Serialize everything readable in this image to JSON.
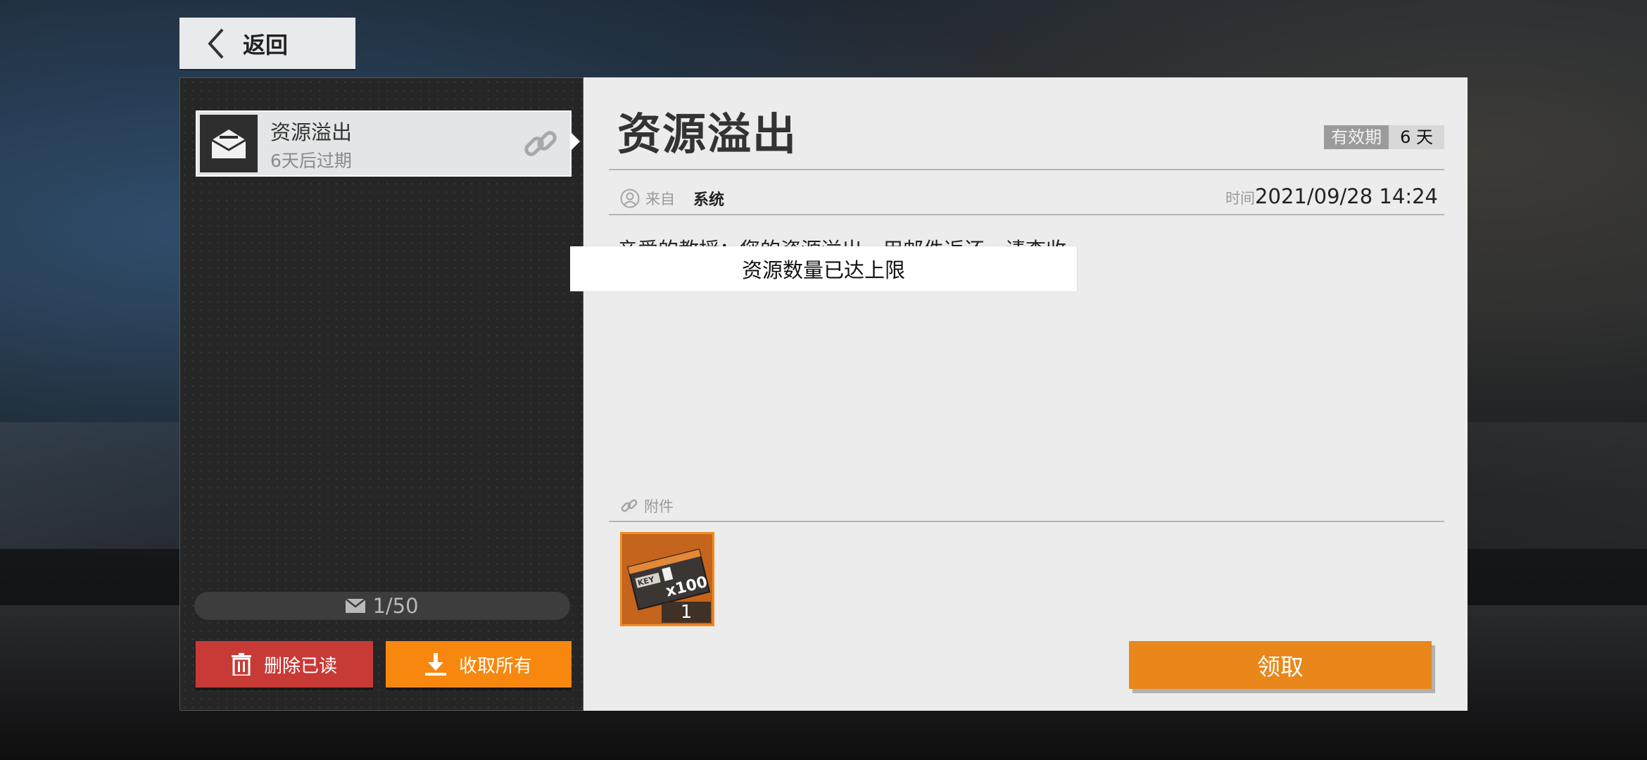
{
  "header": {
    "back_label": "返回"
  },
  "mail_list": {
    "items": [
      {
        "title": "资源溢出",
        "subtitle": "6天后过期"
      }
    ],
    "count_text": "1/50",
    "delete_read_label": "删除已读",
    "collect_all_label": "收取所有"
  },
  "detail": {
    "title": "资源溢出",
    "validity_label": "有效期",
    "validity_value": "6 天",
    "from_label": "来自",
    "from_value": "系统",
    "time_label": "时间",
    "time_value": "2021/09/28 14:24",
    "body": "亲爱的教授：您的资源溢出，用邮件返还，请查收",
    "attachments_label": "附件",
    "attachment_item": {
      "name": "KEY x100",
      "quantity": "1"
    },
    "claim_label": "领取"
  },
  "toast": {
    "text": "资源数量已达上限"
  },
  "colors": {
    "accent_orange": "#f7870f",
    "claim_orange": "#e9871b",
    "delete_red": "#c83a36",
    "panel_light": "#ececec",
    "panel_dark": "#262626"
  },
  "icons": [
    "chevron-left-icon",
    "envelope-open-icon",
    "link-icon",
    "envelope-icon",
    "trash-icon",
    "download-icon",
    "user-icon",
    "item-key-ticket-icon"
  ]
}
